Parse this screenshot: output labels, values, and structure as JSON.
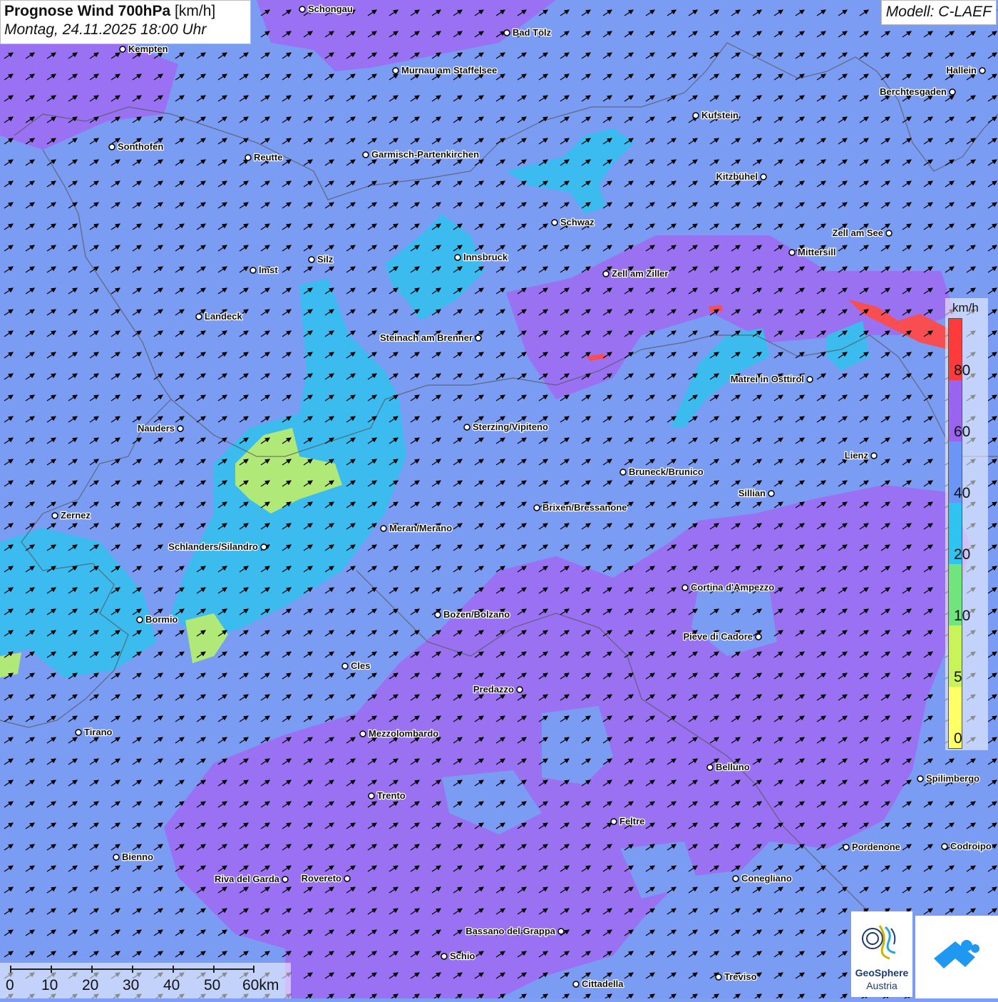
{
  "header": {
    "title_bold": "Prognose Wind 700hPa",
    "title_unit": " [km/h]",
    "datetime": "Montag, 24.11.2025 18:00 Uhr"
  },
  "model_label": "Modell: C-LAEF",
  "legend": {
    "unit": "km/h",
    "labels": [
      "80",
      "60",
      "40",
      "20",
      "10",
      "5",
      "0"
    ],
    "colors": [
      "#ff3a3a",
      "#9a63f0",
      "#6b96f5",
      "#2ec3f0",
      "#70e57b",
      "#c8f45a",
      "#ffff66"
    ]
  },
  "scale_bar": {
    "labels": [
      "0",
      "10",
      "20",
      "30",
      "40",
      "50",
      "60km"
    ]
  },
  "logos": {
    "geosphere_line1": "GeoSphere",
    "geosphere_line2": "Austria"
  },
  "cities": [
    {
      "name": "Schongau"
    },
    {
      "name": "Bad Tölz"
    },
    {
      "name": "Kempten"
    },
    {
      "name": "Murnau am Staffelsee"
    },
    {
      "name": "Hallein"
    },
    {
      "name": "Berchtesgaden"
    },
    {
      "name": "Kufstein"
    },
    {
      "name": "Sonthofen"
    },
    {
      "name": "Reutte"
    },
    {
      "name": "Garmisch-Partenkirchen"
    },
    {
      "name": "Kitzbühel"
    },
    {
      "name": "Schwaz"
    },
    {
      "name": "Zell am See"
    },
    {
      "name": "Mittersill"
    },
    {
      "name": "Innsbruck"
    },
    {
      "name": "Silz"
    },
    {
      "name": "Imst"
    },
    {
      "name": "Zell am Ziller"
    },
    {
      "name": "Landeck"
    },
    {
      "name": "Steinach am Brenner"
    },
    {
      "name": "Matrei in Osttirol"
    },
    {
      "name": "Nauders"
    },
    {
      "name": "Sterzing/Vipiteno"
    },
    {
      "name": "Lienz"
    },
    {
      "name": "Bruneck/Brunico"
    },
    {
      "name": "Sillian"
    },
    {
      "name": "Brixen/Bressanone"
    },
    {
      "name": "Zernez"
    },
    {
      "name": "Meran/Merano"
    },
    {
      "name": "Schlanders/Silandro"
    },
    {
      "name": "Cortina d'Ampezzo"
    },
    {
      "name": "Bozen/Bolzano"
    },
    {
      "name": "Bormio"
    },
    {
      "name": "Pieve di Cadore"
    },
    {
      "name": "Cles"
    },
    {
      "name": "Predazzo"
    },
    {
      "name": "Tirano"
    },
    {
      "name": "Mezzolombardo"
    },
    {
      "name": "Belluno"
    },
    {
      "name": "Spilimbergo"
    },
    {
      "name": "Trento"
    },
    {
      "name": "Feltre"
    },
    {
      "name": "Pordenone"
    },
    {
      "name": "Codroipo"
    },
    {
      "name": "Bienno"
    },
    {
      "name": "Riva del Garda"
    },
    {
      "name": "Rovereto"
    },
    {
      "name": "Conegliano"
    },
    {
      "name": "Bassano del Grappa"
    },
    {
      "name": "Schio"
    },
    {
      "name": "Treviso"
    },
    {
      "name": "Cittadella"
    }
  ]
}
